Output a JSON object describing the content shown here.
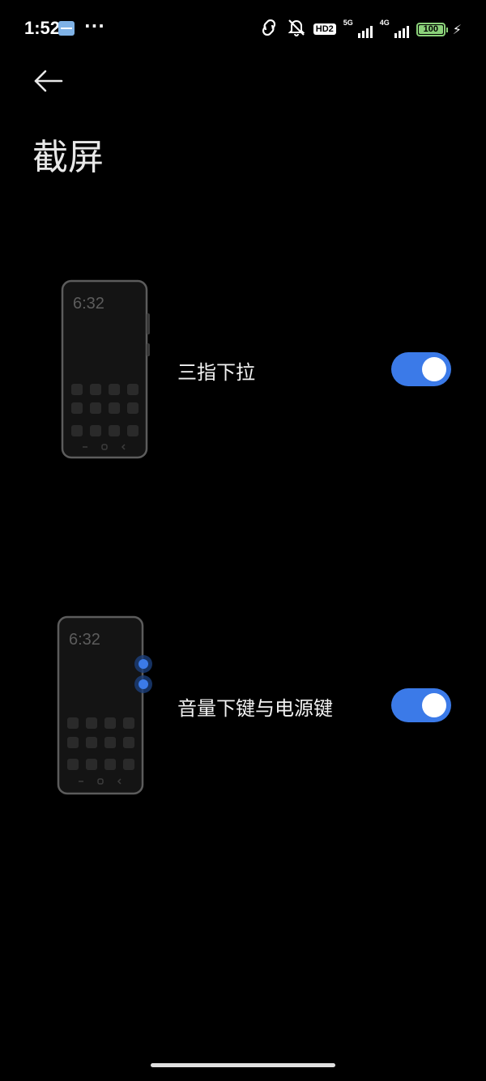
{
  "status_bar": {
    "time": "1:52",
    "overflow": "···",
    "hd_badge": "HD2",
    "signal_1_gen": "5G",
    "signal_2_gen": "4G",
    "battery_level": "100",
    "icons": [
      "mail-icon",
      "hotspot-link-icon",
      "mute-icon",
      "signal-icon",
      "battery-icon",
      "charging-icon"
    ],
    "battery_color": "#8bd17a"
  },
  "header": {
    "back_icon": "arrow-left-icon",
    "title": "截屏"
  },
  "settings": [
    {
      "label": "三指下拉",
      "enabled": true,
      "illustration_time": "6:32"
    },
    {
      "label": "音量下键与电源键",
      "enabled": true,
      "illustration_time": "6:32"
    }
  ],
  "colors": {
    "background": "#000000",
    "accent": "#3b7ae8",
    "text": "#f2f2f2"
  }
}
